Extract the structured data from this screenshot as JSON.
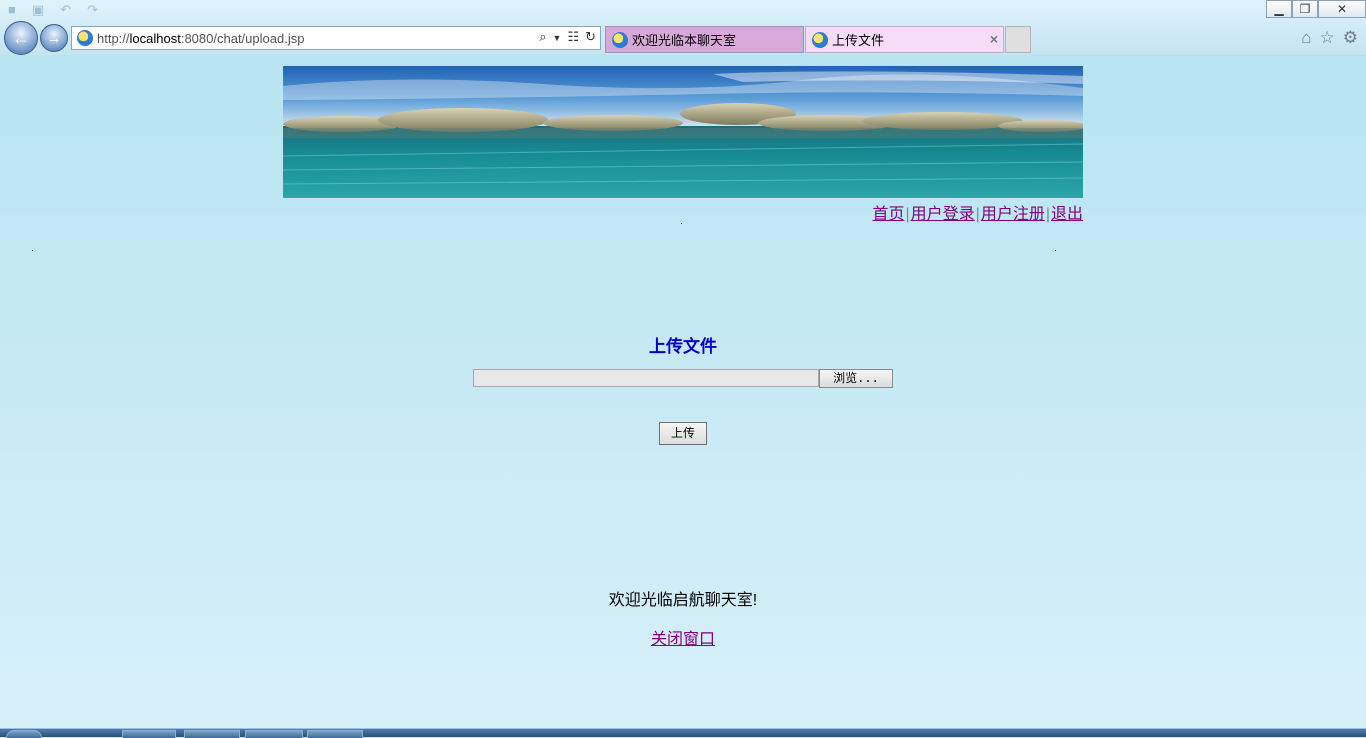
{
  "browser": {
    "url_prefix": "http://",
    "url_host": "localhost",
    "url_rest": ":8080/chat/upload.jsp",
    "tabs": [
      {
        "label": "欢迎光临本聊天室",
        "active": false
      },
      {
        "label": "上传文件",
        "active": true
      }
    ],
    "icons": [
      "back-icon",
      "forward-icon",
      "search-icon",
      "compat-view-icon",
      "refresh-icon",
      "home-icon",
      "favorites-star-icon",
      "tools-gear-icon"
    ]
  },
  "header": {
    "nav": [
      {
        "label": "首页"
      },
      {
        "label": "用户登录"
      },
      {
        "label": "用户注册"
      },
      {
        "label": "退出"
      }
    ],
    "separator": "|"
  },
  "upload": {
    "title": "上传文件",
    "browse_label": "浏览...",
    "submit_label": "上传"
  },
  "footer": {
    "welcome": "欢迎光临启航聊天室!",
    "close_label": "关闭窗口"
  },
  "colors": {
    "link": "#800080",
    "title": "#0000cc",
    "page_bg": "#c7e9f3"
  }
}
